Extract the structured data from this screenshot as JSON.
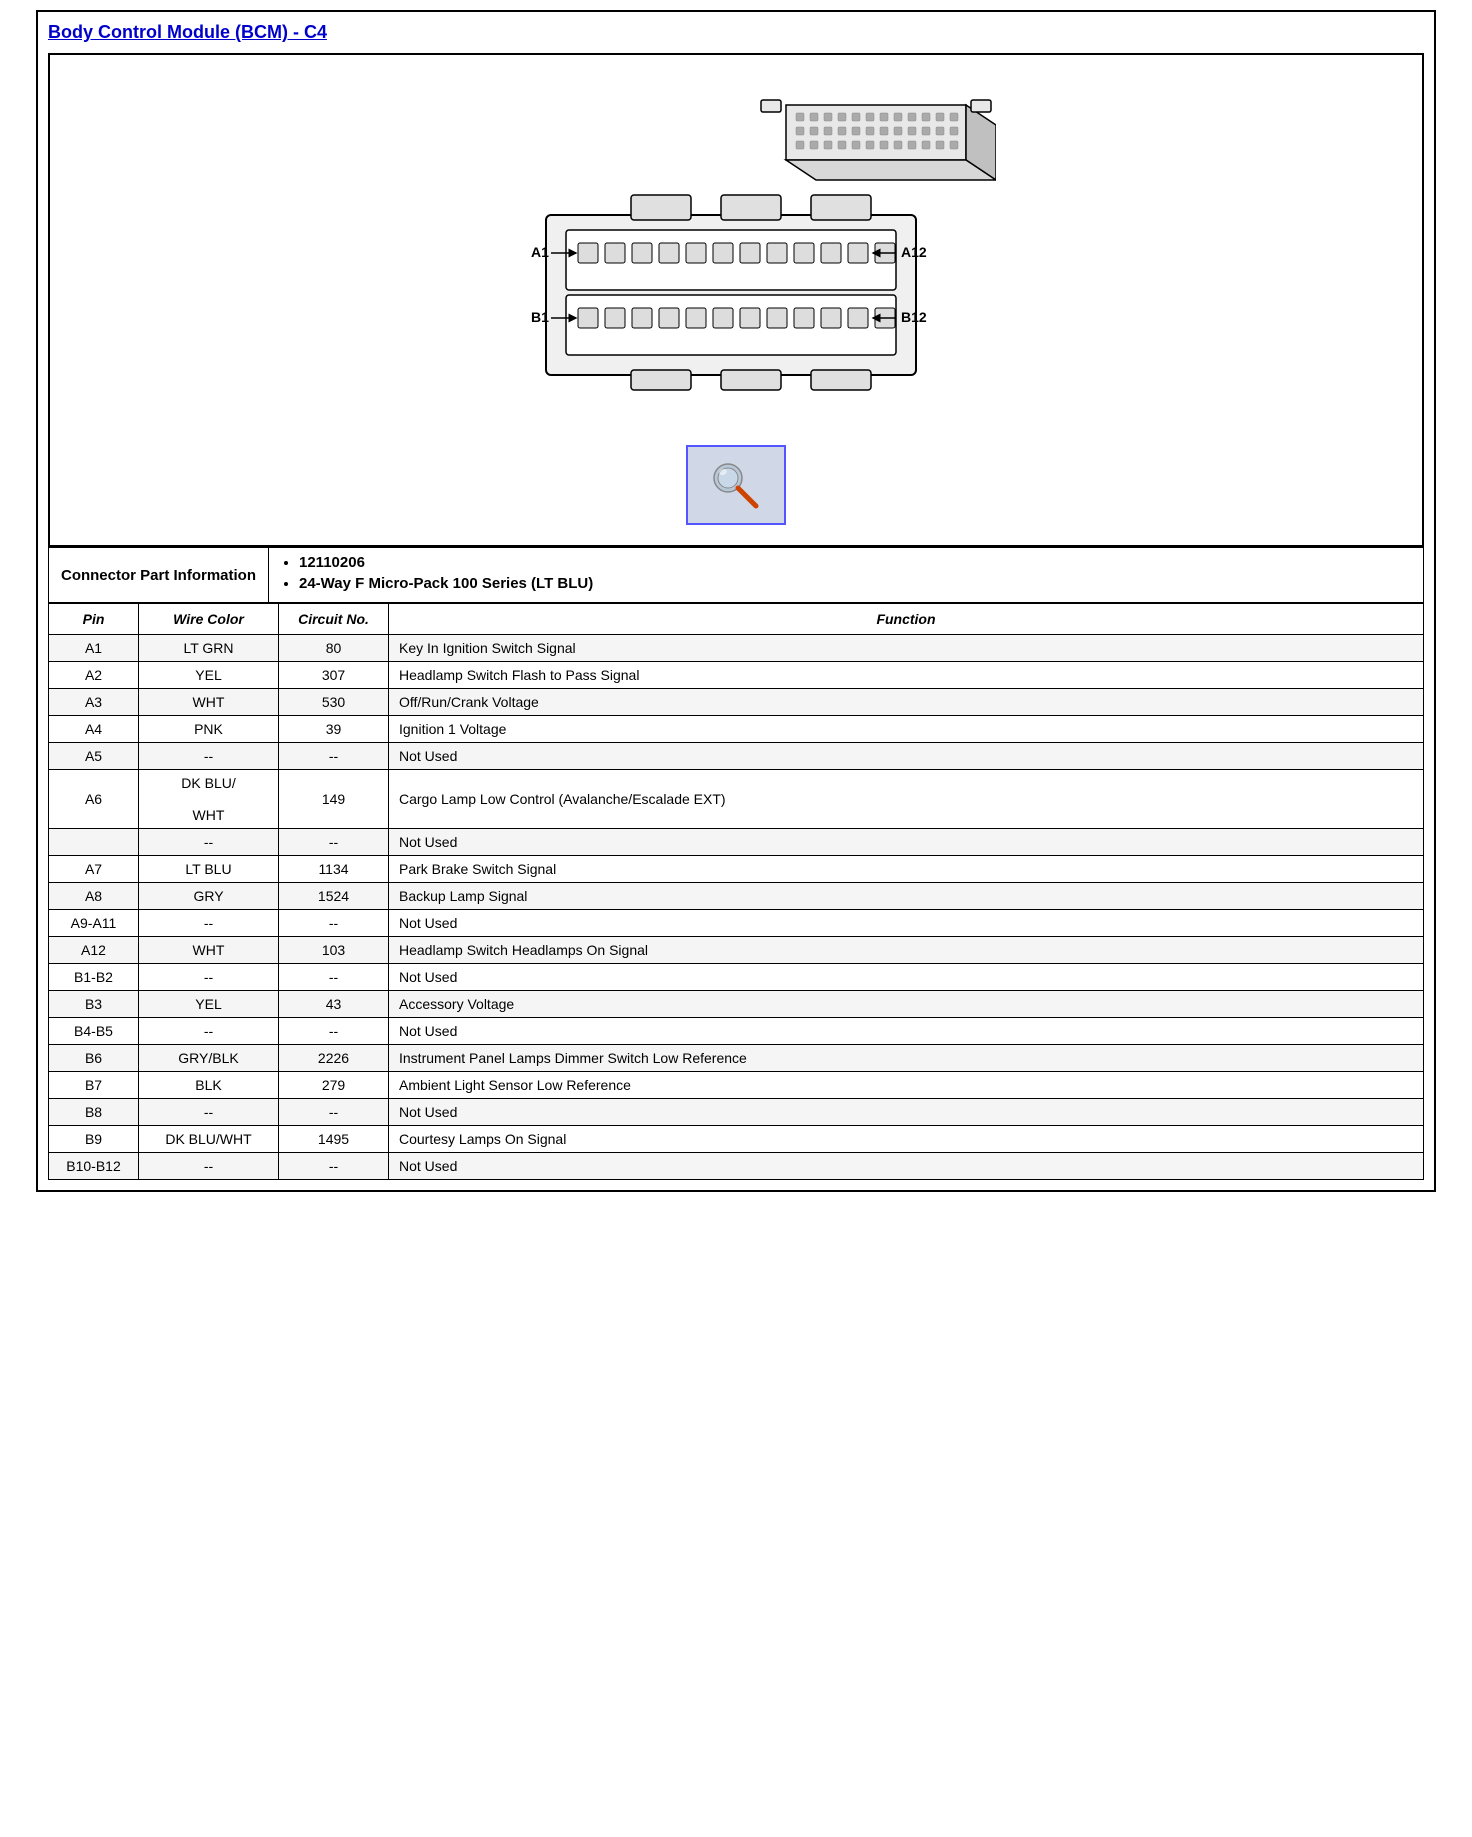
{
  "title": "Body Control Module (BCM) - C4",
  "connector_part_label": "Connector Part Information",
  "connector_part_numbers": [
    "12110206",
    "24-Way F Micro-Pack 100 Series (LT BLU)"
  ],
  "table_headers": {
    "pin": "Pin",
    "wire_color": "Wire Color",
    "circuit_no": "Circuit No.",
    "function": "Function"
  },
  "pins": [
    {
      "pin": "A1",
      "wire_color": "LT GRN",
      "circuit_no": "80",
      "function": "Key In Ignition Switch Signal"
    },
    {
      "pin": "A2",
      "wire_color": "YEL",
      "circuit_no": "307",
      "function": "Headlamp Switch Flash to Pass Signal"
    },
    {
      "pin": "A3",
      "wire_color": "WHT",
      "circuit_no": "530",
      "function": "Off/Run/Crank Voltage"
    },
    {
      "pin": "A4",
      "wire_color": "PNK",
      "circuit_no": "39",
      "function": "Ignition 1 Voltage"
    },
    {
      "pin": "A5",
      "wire_color": "--",
      "circuit_no": "--",
      "function": "Not Used"
    },
    {
      "pin": "A6",
      "wire_color": "DK BLU/\n\nWHT",
      "circuit_no": "149",
      "function": "Cargo Lamp Low Control (Avalanche/Escalade EXT)",
      "multiline_wire": true
    },
    {
      "pin": "",
      "wire_color": "--",
      "circuit_no": "--",
      "function": "Not Used",
      "separator": true
    },
    {
      "pin": "A7",
      "wire_color": "LT BLU",
      "circuit_no": "1134",
      "function": "Park Brake Switch Signal"
    },
    {
      "pin": "A8",
      "wire_color": "GRY",
      "circuit_no": "1524",
      "function": "Backup Lamp Signal"
    },
    {
      "pin": "A9-A11",
      "wire_color": "--",
      "circuit_no": "--",
      "function": "Not Used"
    },
    {
      "pin": "A12",
      "wire_color": "WHT",
      "circuit_no": "103",
      "function": "Headlamp Switch Headlamps On Signal"
    },
    {
      "pin": "B1-B2",
      "wire_color": "--",
      "circuit_no": "--",
      "function": "Not Used"
    },
    {
      "pin": "B3",
      "wire_color": "YEL",
      "circuit_no": "43",
      "function": "Accessory Voltage"
    },
    {
      "pin": "B4-B5",
      "wire_color": "--",
      "circuit_no": "--",
      "function": "Not Used"
    },
    {
      "pin": "B6",
      "wire_color": "GRY/BLK",
      "circuit_no": "2226",
      "function": "Instrument Panel Lamps Dimmer Switch Low Reference"
    },
    {
      "pin": "B7",
      "wire_color": "BLK",
      "circuit_no": "279",
      "function": "Ambient Light Sensor Low Reference"
    },
    {
      "pin": "B8",
      "wire_color": "--",
      "circuit_no": "--",
      "function": "Not Used"
    },
    {
      "pin": "B9",
      "wire_color": "DK BLU/WHT",
      "circuit_no": "1495",
      "function": "Courtesy Lamps On Signal"
    },
    {
      "pin": "B10-B12",
      "wire_color": "--",
      "circuit_no": "--",
      "function": "Not Used"
    }
  ]
}
